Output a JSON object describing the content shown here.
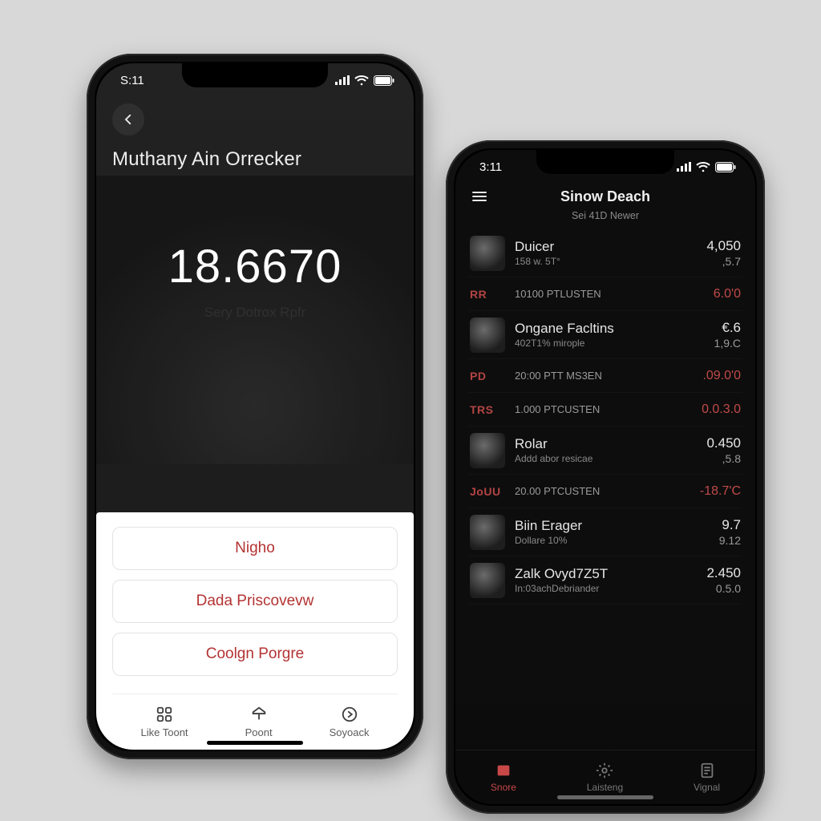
{
  "phone1": {
    "status": {
      "time": "S:11"
    },
    "title": "Muthany Ain Orrecker",
    "big_value": "18.6670",
    "subtitle": "Sery Dotrox Rpfr",
    "options": [
      "Nigho",
      "Dada Priscovevw",
      "Coolgn Porgre"
    ],
    "tabs": [
      "Like Toont",
      "Poont",
      "Soyoack"
    ]
  },
  "phone2": {
    "status": {
      "time": "3:11"
    },
    "title": "Sinow Deach",
    "subtitle": "Sei 41D Newer",
    "rows": [
      {
        "kind": "big",
        "label": "Duicer",
        "sub": "158 w. 5T°",
        "v1": "4,050",
        "v2": ",5.7"
      },
      {
        "kind": "small",
        "code": "RR",
        "label": "10100 PTLUSTEN",
        "v1": "6.0'0",
        "red": true
      },
      {
        "kind": "big",
        "label": "Ongane Facltins",
        "sub": "402T1% mirople",
        "v1": "€.6",
        "v2": "1,9.C"
      },
      {
        "kind": "small",
        "code": "PD",
        "label": "20:00 PTT MS3EN",
        "v1": ".09.0'0",
        "red": true
      },
      {
        "kind": "small",
        "code": "TRS",
        "label": "1.000 PTCUSTEN",
        "v1": "0.0.3.0",
        "red": true
      },
      {
        "kind": "big",
        "label": "Rolar",
        "sub": "Addd abor resicae",
        "v1": "0.450",
        "v2": ",5.8"
      },
      {
        "kind": "small",
        "code": "JoUU",
        "label": "20.00 PTCUSTEN",
        "v1": "-18.7'C",
        "red": true
      },
      {
        "kind": "big",
        "label": "Biin Erager",
        "sub": "Dollare 10%",
        "v1": "9.7",
        "v2": "9.12"
      },
      {
        "kind": "big",
        "label": "Zalk Ovyd7Z5T",
        "sub": "In:03achDebriander",
        "v1": "2.450",
        "v2": "0.5.0"
      }
    ],
    "tabs": [
      {
        "label": "Snore",
        "active": true
      },
      {
        "label": "Laisteng",
        "active": false
      },
      {
        "label": "Vignal",
        "active": false
      }
    ]
  }
}
